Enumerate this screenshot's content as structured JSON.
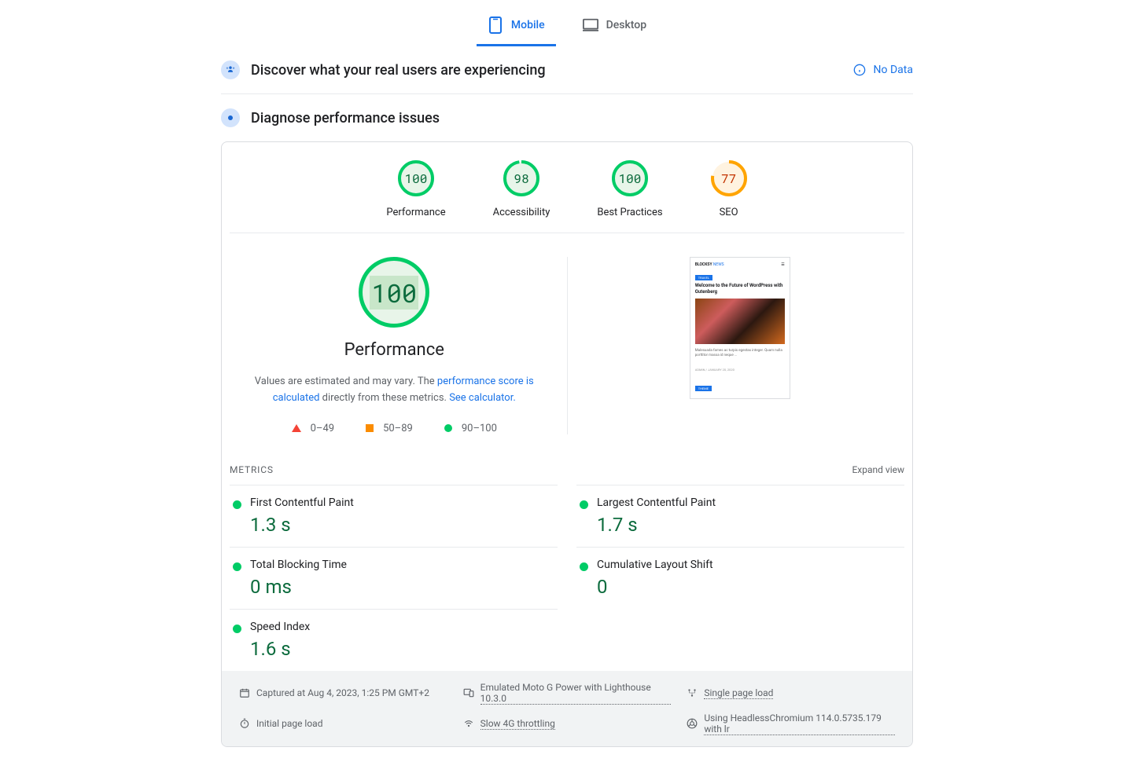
{
  "tabs": {
    "mobile": "Mobile",
    "desktop": "Desktop"
  },
  "sections": {
    "discover": "Discover what your real users are experiencing",
    "diagnose": "Diagnose performance issues",
    "no_data": "No Data"
  },
  "scores": {
    "performance": {
      "value": "100",
      "label": "Performance"
    },
    "accessibility": {
      "value": "98",
      "label": "Accessibility"
    },
    "best_practices": {
      "value": "100",
      "label": "Best Practices"
    },
    "seo": {
      "value": "77",
      "label": "SEO"
    }
  },
  "perf_detail": {
    "score": "100",
    "title": "Performance",
    "desc_prefix": "Values are estimated and may vary. The ",
    "desc_link1": "performance score is calculated",
    "desc_mid": " directly from these metrics. ",
    "desc_link2": "See calculator.",
    "legend": {
      "red": "0–49",
      "orange": "50–89",
      "green": "90–100"
    }
  },
  "preview": {
    "logo1": "BLOCKSY",
    "logo2": "NEWS",
    "badge": "TRAVEL",
    "title": "Welcome to the Future of WordPress with Gutenberg",
    "text": "Malesuada fames ac turpis egestas integer. Quam nulla porttitor massa id neque …",
    "meta": "ADMIN  /  JANUARY 20, 2020",
    "badge2": "THEME"
  },
  "metrics_header": {
    "title": "METRICS",
    "expand": "Expand view"
  },
  "metrics": {
    "fcp": {
      "name": "First Contentful Paint",
      "value": "1.3 s"
    },
    "lcp": {
      "name": "Largest Contentful Paint",
      "value": "1.7 s"
    },
    "tbt": {
      "name": "Total Blocking Time",
      "value": "0 ms"
    },
    "cls": {
      "name": "Cumulative Layout Shift",
      "value": "0"
    },
    "si": {
      "name": "Speed Index",
      "value": "1.6 s"
    }
  },
  "footer": {
    "captured": "Captured at Aug 4, 2023, 1:25 PM GMT+2",
    "emulated": "Emulated Moto G Power with Lighthouse 10.3.0",
    "single": "Single page load",
    "initial": "Initial page load",
    "throttling": "Slow 4G throttling",
    "browser": "Using HeadlessChromium 114.0.5735.179 with lr"
  }
}
